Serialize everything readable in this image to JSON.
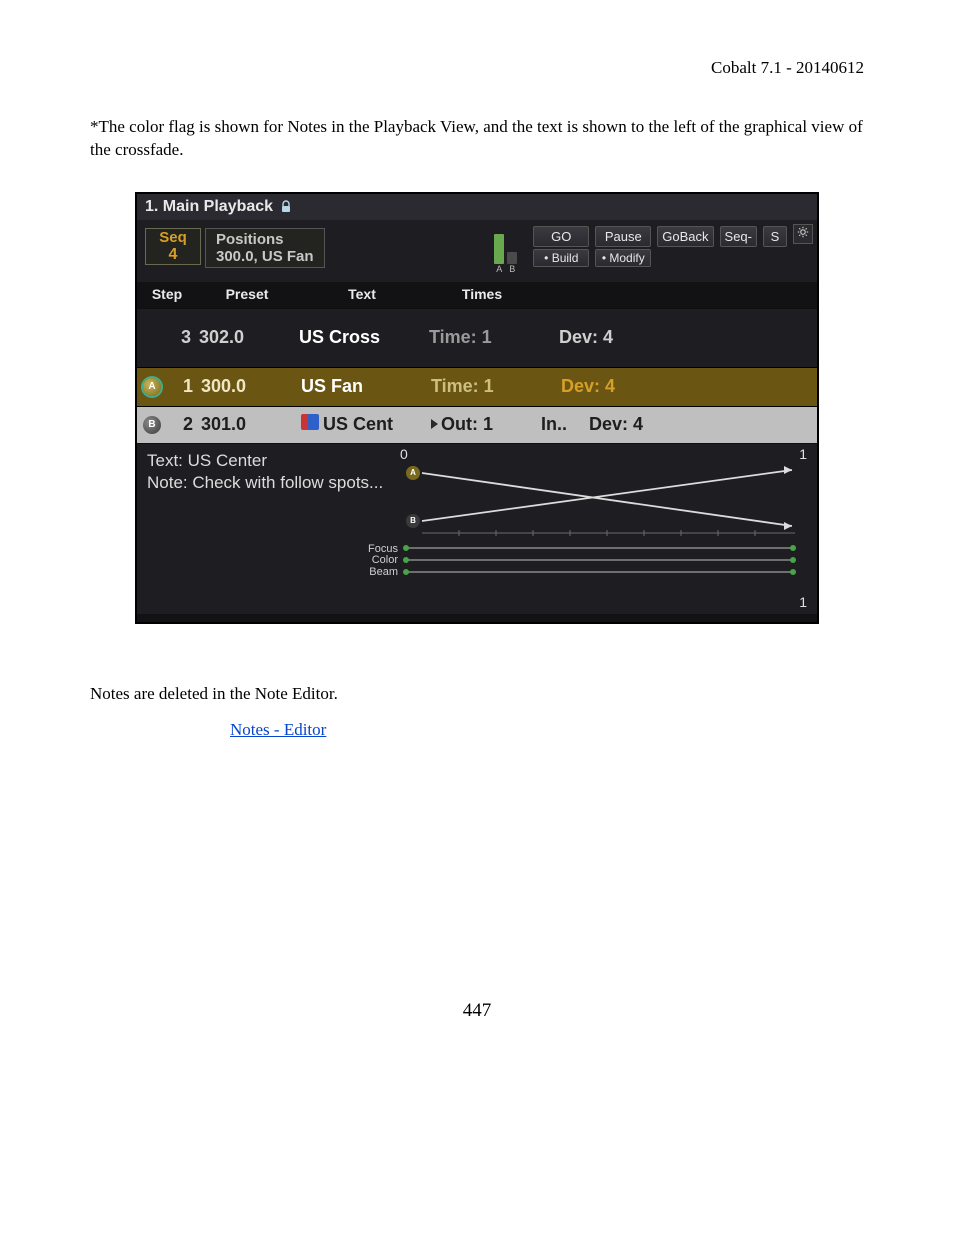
{
  "doc_header": "Cobalt 7.1 - 20140612",
  "intro": "*The color flag is shown for Notes in the Playback View, and the text is shown to the left of the graphical view of the crossfade.",
  "title": "1. Main Playback",
  "seq": {
    "label": "Seq",
    "num": "4"
  },
  "positions": {
    "title": "Positions",
    "value": "300.0, US Fan"
  },
  "ab_markers": {
    "a": "A",
    "b": "B"
  },
  "buttons": {
    "go": "GO",
    "pause": "Pause",
    "goback": "GoBack",
    "seq_minus": "Seq-",
    "build": "• Build",
    "modify": "• Modify",
    "scut": "S"
  },
  "columns": {
    "step": "Step",
    "preset": "Preset",
    "text": "Text",
    "times": "Times"
  },
  "rows": {
    "plain": {
      "step": "3",
      "preset": "302.0",
      "text": "US Cross",
      "time": "Time: 1",
      "dev": "Dev: 4"
    },
    "a": {
      "step": "1",
      "preset": "300.0",
      "text": "US Fan",
      "time": "Time: 1",
      "dev": "Dev: 4"
    },
    "b": {
      "step": "2",
      "preset": "301.0",
      "text": "US Cent",
      "out": "Out: 1",
      "in": "In..",
      "dev": "Dev: 4"
    }
  },
  "bottom": {
    "text_label": "Text: US Center",
    "note_label": "Note: Check with follow spots...",
    "axis0": "0",
    "axis1_top": "1",
    "axis1_bot": "1",
    "focus": "Focus",
    "color": "Color",
    "beam": "Beam"
  },
  "outro": "Notes are deleted in the Note Editor.",
  "link": "Notes - Editor",
  "page_num": "447",
  "chart_data": {
    "type": "line",
    "title": "Crossfade A/B",
    "xlabel": "",
    "ylabel": "",
    "xlim": [
      0,
      1
    ],
    "ylim": [
      0,
      1
    ],
    "series": [
      {
        "name": "A",
        "values": [
          [
            0,
            1
          ],
          [
            1,
            0
          ]
        ]
      },
      {
        "name": "B",
        "values": [
          [
            0,
            0
          ],
          [
            1,
            1
          ]
        ]
      },
      {
        "name": "Focus",
        "values": [
          [
            0,
            0
          ],
          [
            1,
            0
          ]
        ]
      },
      {
        "name": "Color",
        "values": [
          [
            0,
            0
          ],
          [
            1,
            0
          ]
        ]
      },
      {
        "name": "Beam",
        "values": [
          [
            0,
            0
          ],
          [
            1,
            0
          ]
        ]
      }
    ]
  }
}
